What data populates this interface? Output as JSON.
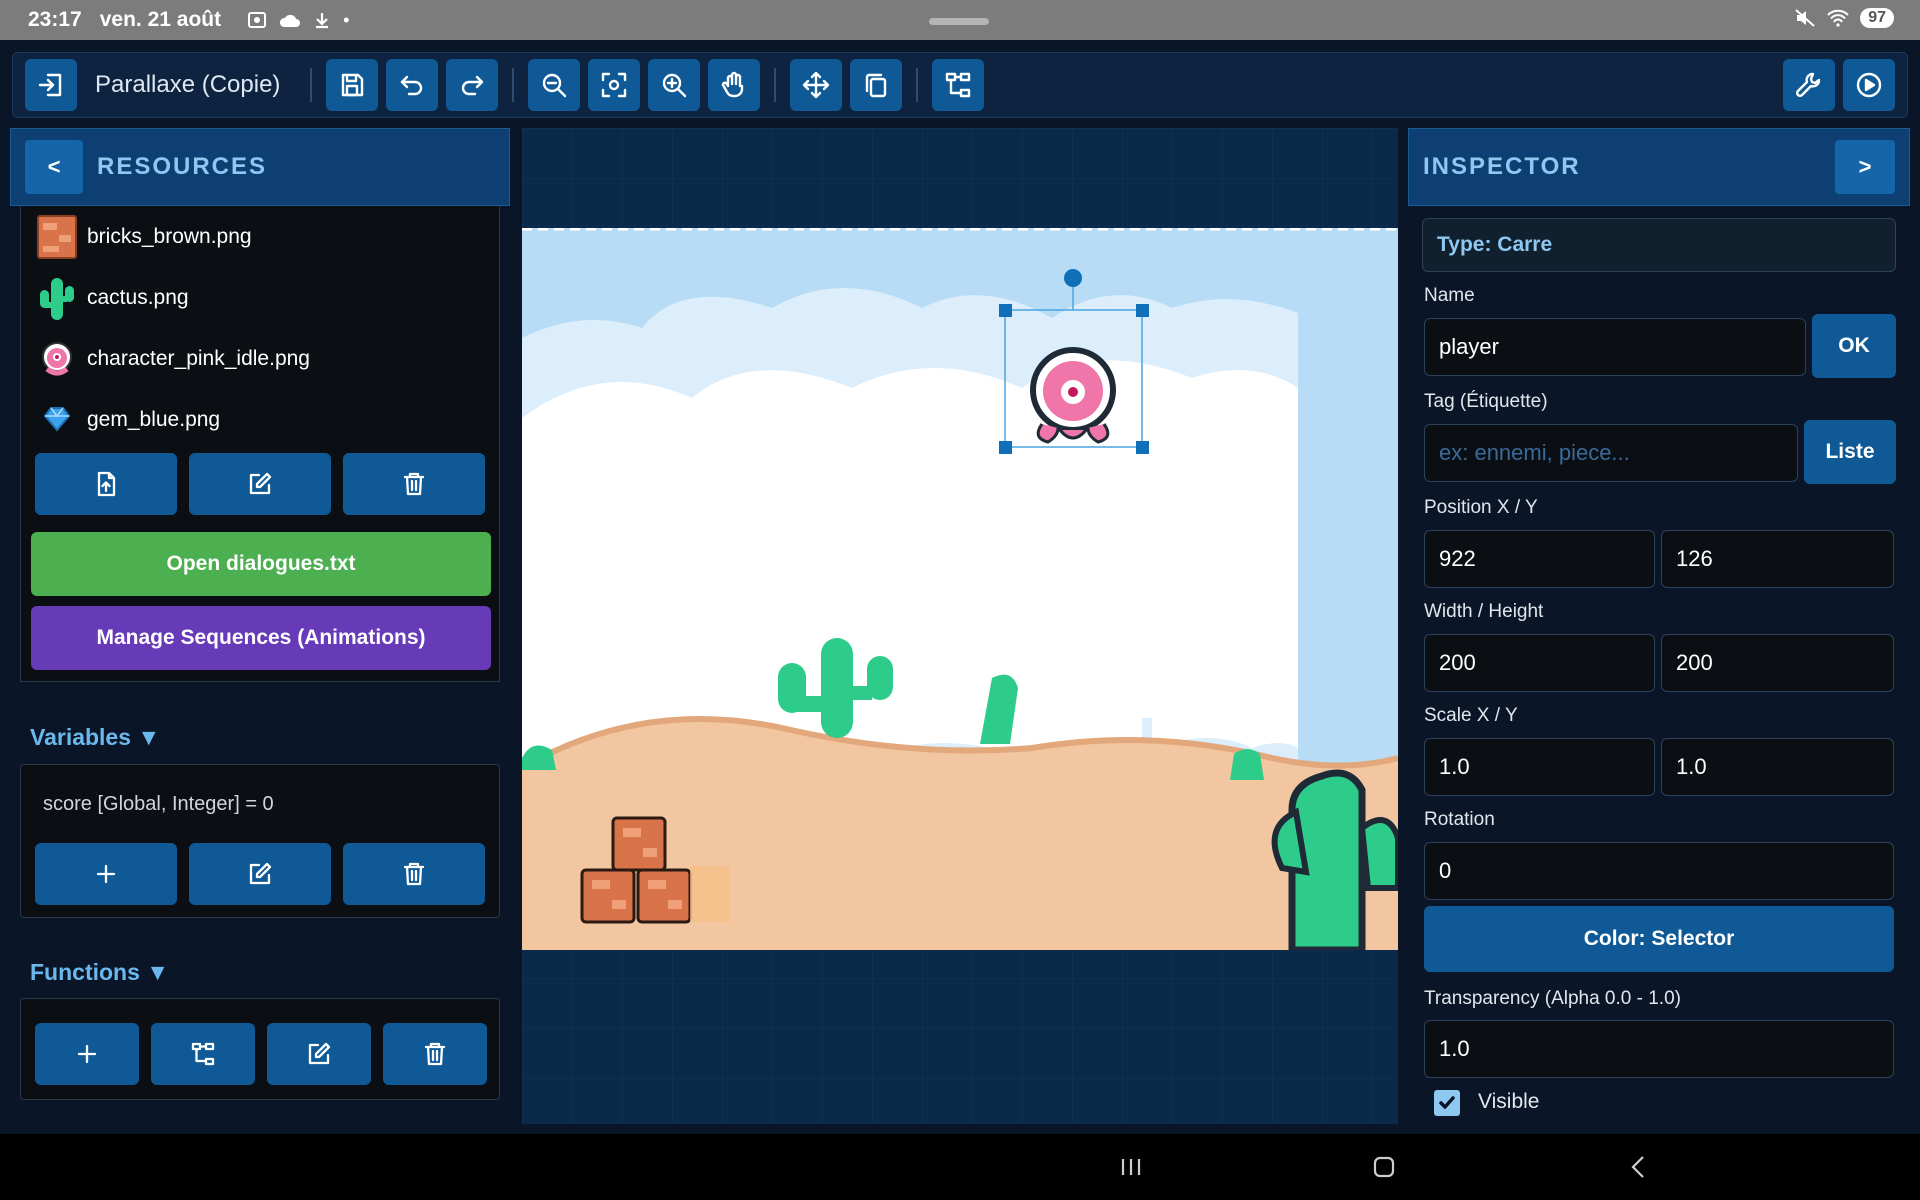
{
  "status_bar": {
    "time": "23:17",
    "date": "ven. 21 août",
    "battery": "97"
  },
  "toolbar": {
    "project_title": "Parallaxe (Copie)",
    "icons": [
      "exit-icon",
      "save-icon",
      "undo-icon",
      "redo-icon",
      "zoom-out-icon",
      "zoom-fit-icon",
      "zoom-in-icon",
      "pan-hand-icon",
      "move-icon",
      "duplicate-icon",
      "hierarchy-icon",
      "wrench-icon",
      "play-icon"
    ]
  },
  "resources": {
    "collapse_label": "<",
    "title": "RESOURCES",
    "items": [
      {
        "name": "bricks_brown.png",
        "icon": "bricks-thumbnail"
      },
      {
        "name": "cactus.png",
        "icon": "cactus-thumbnail"
      },
      {
        "name": "character_pink_idle.png",
        "icon": "character-thumbnail"
      },
      {
        "name": "gem_blue.png",
        "icon": "gem-thumbnail"
      }
    ],
    "open_dialogues_label": "Open dialogues.txt",
    "manage_sequences_label": "Manage Sequences (Animations)"
  },
  "variables": {
    "title": "Variables ▼",
    "items": [
      "score [Global, Integer] = 0"
    ]
  },
  "functions": {
    "title": "Functions ▼"
  },
  "inspector": {
    "title": "INSPECTOR",
    "collapse_label": ">",
    "type_label": "Type: Carre",
    "name_label": "Name",
    "name_value": "player",
    "ok_label": "OK",
    "tag_label": "Tag (Étiquette)",
    "tag_placeholder": "ex: ennemi, piece...",
    "list_label": "Liste",
    "position_label": "Position X / Y",
    "position_x": "922",
    "position_y": "126",
    "size_label": "Width / Height",
    "width": "200",
    "height": "200",
    "scale_label": "Scale X / Y",
    "scale_x": "1.0",
    "scale_y": "1.0",
    "rotation_label": "Rotation",
    "rotation": "0",
    "color_label": "Color: Selector",
    "alpha_label": "Transparency (Alpha 0.0 - 1.0)",
    "alpha": "1.0",
    "visible_label": "Visible",
    "visible": true
  },
  "colors": {
    "accent": "#0f5a96",
    "header": "#0d3f72",
    "green_button": "#4caf50",
    "purple_button": "#673ab7",
    "sky": "#b8dcf6",
    "sand": "#f2c6a0"
  }
}
